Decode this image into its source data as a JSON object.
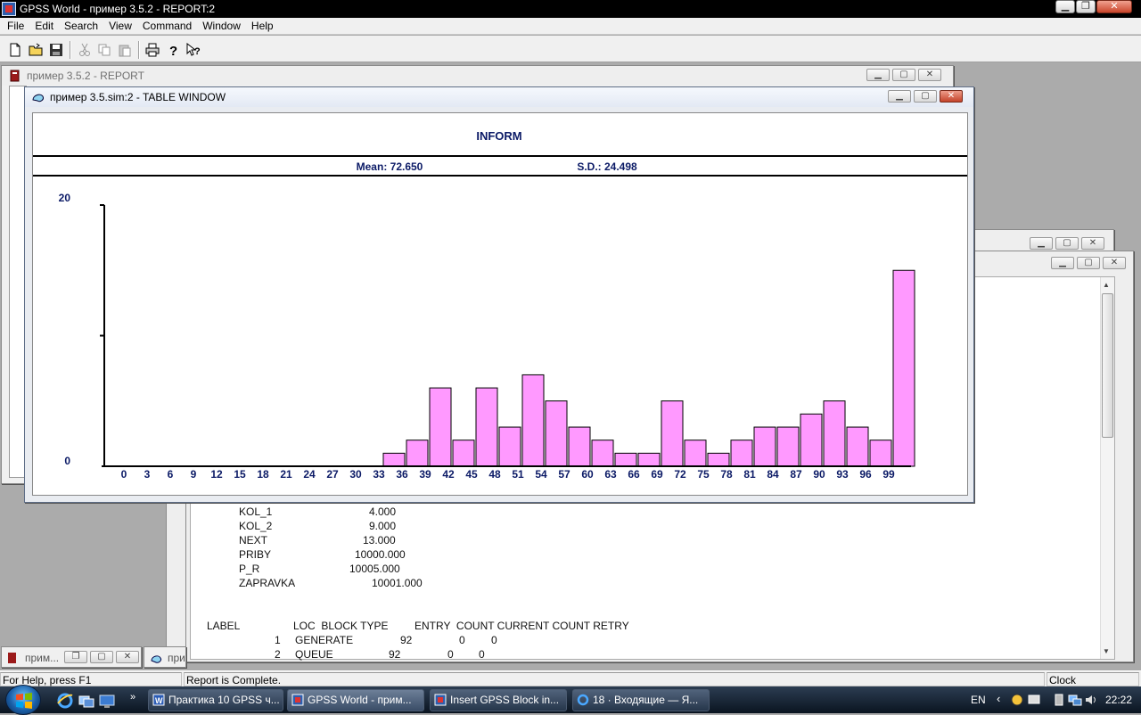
{
  "app": {
    "title": "GPSS World - пример 3.5.2  - REPORT:2",
    "menu": [
      "File",
      "Edit",
      "Search",
      "View",
      "Command",
      "Window",
      "Help"
    ]
  },
  "toolbar": {
    "buttons": [
      "new-file-icon",
      "open-folder-icon",
      "save-icon",
      "cut-icon",
      "copy-icon",
      "paste-icon",
      "print-icon",
      "help-icon",
      "context-help-icon"
    ]
  },
  "report_window": {
    "title": "пример 3.5.2  - REPORT"
  },
  "report_text": {
    "variables": [
      {
        "name": "KOL_1",
        "value": "4.000"
      },
      {
        "name": "KOL_2",
        "value": "9.000"
      },
      {
        "name": "NEXT",
        "value": "13.000"
      },
      {
        "name": "PRIBY",
        "value": "10000.000"
      },
      {
        "name": "P_R",
        "value": "10005.000"
      },
      {
        "name": "ZAPRAVKA",
        "value": "10001.000"
      }
    ],
    "block_header": {
      "label": "LABEL",
      "loc_type": "LOC  BLOCK TYPE",
      "counts": "ENTRY  COUNT CURRENT COUNT RETRY"
    },
    "blocks": [
      {
        "loc": "1",
        "type": "GENERATE",
        "entry": "92",
        "current": "0",
        "retry": "0"
      },
      {
        "loc": "2",
        "type": "QUEUE",
        "entry": "92",
        "current": "0",
        "retry": "0"
      }
    ]
  },
  "table_window": {
    "title": "пример 3.5.sim:2  -  TABLE WINDOW"
  },
  "chart_data": {
    "type": "bar",
    "title": "INFORM",
    "stats": {
      "mean_label": "Mean: 72.650",
      "sd_label": "S.D.: 24.498"
    },
    "y_ticks": [
      "20",
      "0"
    ],
    "ylim": [
      0,
      20
    ],
    "x_tick_labels": [
      "0",
      "3",
      "6",
      "9",
      "12",
      "15",
      "18",
      "21",
      "24",
      "27",
      "30",
      "33",
      "36",
      "39",
      "42",
      "45",
      "48",
      "51",
      "54",
      "57",
      "60",
      "63",
      "66",
      "69",
      "72",
      "75",
      "78",
      "81",
      "84",
      "87",
      "90",
      "93",
      "96",
      "99"
    ],
    "bins": [
      "36",
      "39",
      "42",
      "45",
      "48",
      "51",
      "54",
      "57",
      "60",
      "63",
      "66",
      "69",
      "72",
      "75",
      "78",
      "81",
      "84",
      "87",
      "90",
      "93",
      "96",
      "99",
      "100+"
    ],
    "values": [
      1,
      2,
      6,
      2,
      6,
      3,
      7,
      5,
      3,
      2,
      1,
      1,
      5,
      2,
      1,
      2,
      3,
      3,
      4,
      5,
      3,
      2,
      15
    ],
    "bar_color": "#ff99ff"
  },
  "minimized_windows": [
    {
      "label": "прим..."
    },
    {
      "label": "при"
    }
  ],
  "status": {
    "help": "For Help, press F1",
    "message": "Report is Complete.",
    "clock_label": "Clock"
  },
  "taskbar": {
    "items": [
      {
        "label": "Практика 10 GPSS ч...",
        "icon": "word-doc-icon"
      },
      {
        "label": "GPSS World - прим...",
        "icon": "gpss-app-icon"
      },
      {
        "label": "Insert GPSS Block in...",
        "icon": "gpss-app-icon"
      },
      {
        "label": "18 · Входящие — Я...",
        "icon": "browser-icon"
      }
    ],
    "lang": "EN",
    "time": "22:22"
  }
}
